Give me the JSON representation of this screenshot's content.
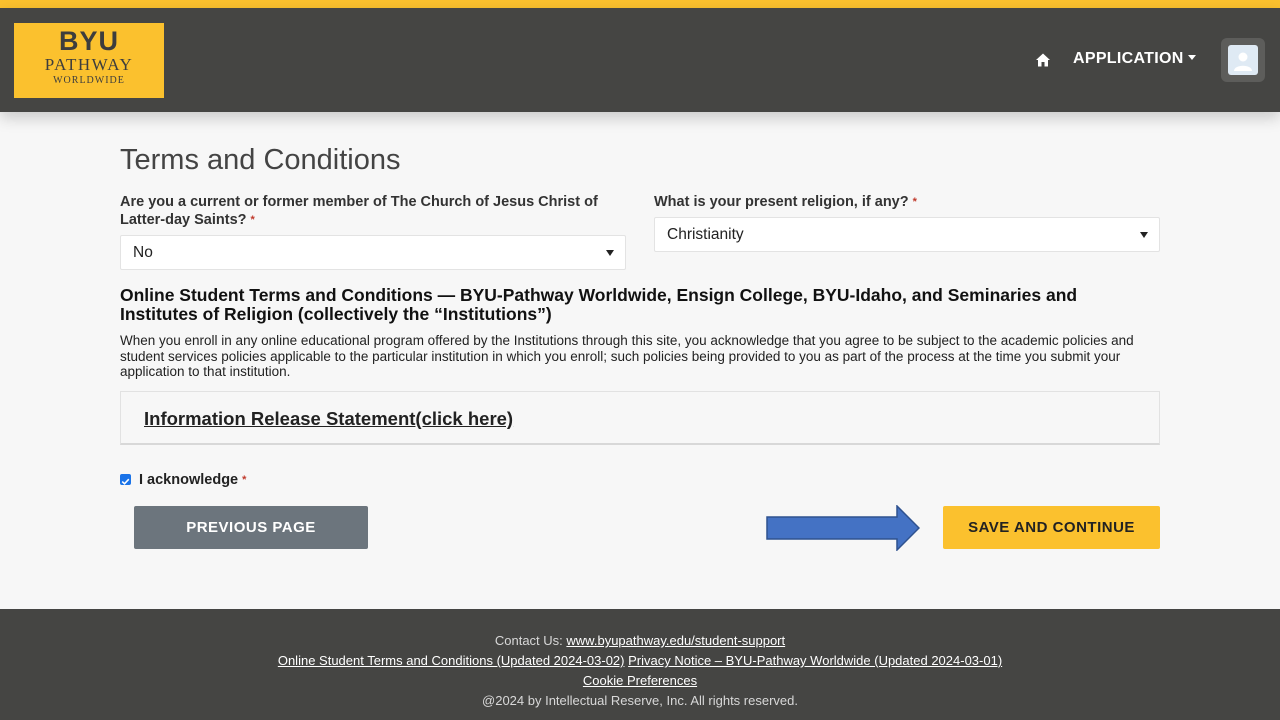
{
  "header": {
    "logo": {
      "line1": "BYU",
      "line2": "PATHWAY",
      "line3": "WORLDWIDE"
    },
    "home_icon": "home-icon",
    "menu_label": "APPLICATION",
    "avatar_icon": "user-avatar-icon"
  },
  "page_title": "Terms and Conditions",
  "questions": {
    "member": {
      "label": "Are you a current or former member of The Church of Jesus Christ of Latter-day Saints?",
      "required_mark": "*",
      "value": "No"
    },
    "religion": {
      "label": "What is your present religion, if any?",
      "required_mark": "*",
      "value": "Christianity"
    }
  },
  "terms": {
    "heading": "Online Student Terms and Conditions — BYU-Pathway Worldwide, Ensign College, BYU-Idaho, and Seminaries and Institutes of Religion (collectively the “Institutions”)",
    "body": "When you enroll in any online educational program offered by the Institutions through this site, you acknowledge that you agree to be subject to the academic policies and student services policies applicable to the particular institution in which you enroll; such policies being provided to you as part of the process at the time you submit your application to that institution.",
    "release_link": "Information Release Statement(click here)"
  },
  "acknowledge": {
    "label": "I acknowledge",
    "required_mark": "*",
    "checked": true
  },
  "buttons": {
    "previous": "PREVIOUS PAGE",
    "save": "SAVE AND CONTINUE"
  },
  "footer": {
    "contact_prefix": "Contact Us:",
    "contact_link": "www.byupathway.edu/student-support",
    "terms_link": "Online Student Terms and Conditions (Updated 2024-03-02)",
    "privacy_link": "Privacy Notice – BYU-Pathway Worldwide (Updated 2024-03-01)",
    "cookie_link": "Cookie Preferences",
    "copyright": "@2024 by Intellectual Reserve, Inc. All rights reserved."
  },
  "colors": {
    "accent": "#fbc12e",
    "header_bg": "#454543",
    "secondary_button": "#6c757d",
    "arrow_fill": "#4472c4",
    "checkbox": "#1a73e8"
  }
}
